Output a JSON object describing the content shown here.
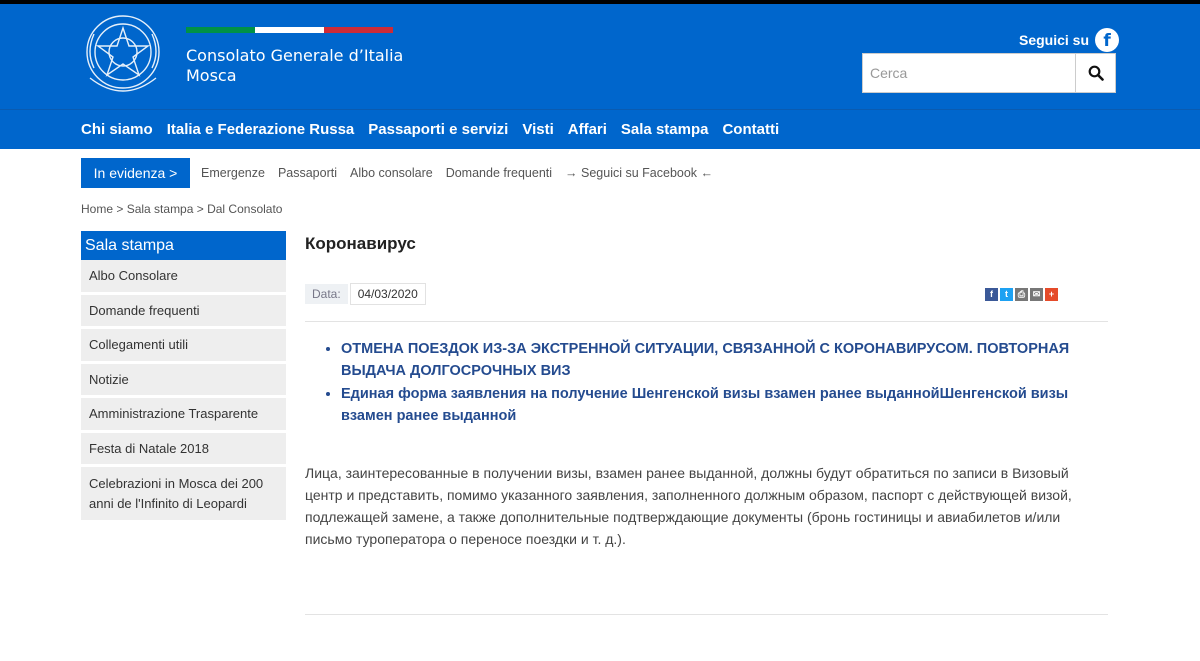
{
  "header": {
    "site_name_line1": "Consolato Generale d’Italia",
    "site_name_line2": "Mosca",
    "follow_label": "Seguici su",
    "search_placeholder": "Cerca",
    "colors": {
      "brand": "#0066cc",
      "flag_green": "#009246",
      "flag_white": "#ffffff",
      "flag_red": "#ce2b37"
    }
  },
  "nav": {
    "items": [
      "Chi siamo",
      "Italia e Federazione Russa",
      "Passaporti e servizi",
      "Visti",
      "Affari",
      "Sala stampa",
      "Contatti"
    ]
  },
  "highlight": {
    "button_label": "In evidenza >",
    "links": [
      "Emergenze",
      "Passaporti",
      "Albo consolare",
      "Domande frequenti",
      "→ Seguici su Facebook ←"
    ]
  },
  "breadcrumb": {
    "items": [
      "Home",
      "Sala stampa",
      "Dal Consolato"
    ],
    "separator": " > "
  },
  "sidebar": {
    "title": "Sala stampa",
    "items": [
      "Albo Consolare",
      "Domande frequenti",
      "Collegamenti utili",
      "Notizie",
      "Amministrazione Trasparente",
      "Festa di Natale 2018",
      "Celebrazioni in Mosca dei 200 anni de l'Infinito di Leopardi"
    ]
  },
  "article": {
    "title": "Коронавирус",
    "date_label": "Data:",
    "date_value": "04/03/2020",
    "links": [
      "ОТМЕНА ПОЕЗДОК ИЗ-ЗА ЭКСТРЕННОЙ СИТУАЦИИ, СВЯЗАННОЙ С КОРОНАВИРУСОМ. ПОВТОРНАЯ ВЫДАЧА ДОЛГОСРОЧНЫХ ВИЗ",
      "Единая форма заявления на получение Шенгенской визы взамен ранее выданнойШенгенской визы взамен ранее выданной"
    ],
    "body": "Лица, заинтересованные в получении визы, взамен ранее выданной, должны будут обратиться по записи в Визовый центр и представить, помимо указанного заявления, заполненного должным образом, паспорт с действующей визой, подлежащей замене, а также дополнительные подтверждающие документы (бронь гостиницы и авиабилетов и/или письмо туроператора о переносе поездки и т. д.).",
    "share_icons": [
      "facebook-icon",
      "twitter-icon",
      "print-icon",
      "email-icon",
      "more-icon"
    ]
  }
}
